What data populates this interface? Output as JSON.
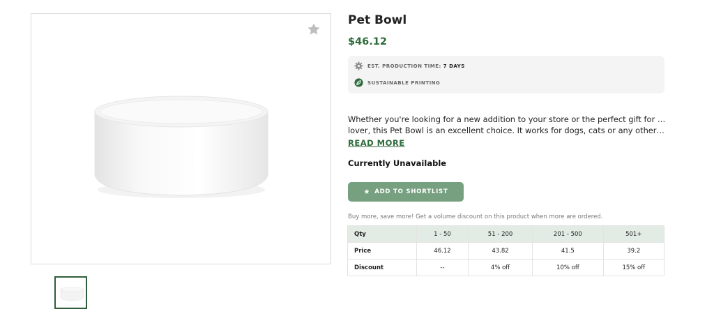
{
  "product": {
    "title": "Pet Bowl",
    "price": "$46.12",
    "production_label": "EST. PRODUCTION TIME:",
    "production_value": "7 DAYS",
    "sustainable_label": "SUSTAINABLE PRINTING",
    "description_line1": "Whether you're looking for a new addition to your store or the perfect gift for a pet",
    "description_line2": "lover, this Pet Bowl is an excellent choice. It works for dogs, cats or any other type o…",
    "read_more": "READ MORE",
    "availability": "Currently Unavailable",
    "shortlist_label": "ADD TO SHORTLIST",
    "volume_note": "Buy more, save more! Get a volume discount on this product when more are ordered."
  },
  "pricing_table": {
    "headers": [
      "Qty",
      "1 - 50",
      "51 - 200",
      "201 - 500",
      "501+"
    ],
    "rows": [
      [
        "Price",
        "46.12",
        "43.82",
        "41.5",
        "39.2"
      ],
      [
        "Discount",
        "--",
        "4% off",
        "10% off",
        "15% off"
      ]
    ]
  },
  "colors": {
    "accent_green": "#2e6b3b",
    "button_green": "#76a07f",
    "table_header_bg": "#e2ebe4"
  },
  "icons": {
    "favorite": "star-icon",
    "production": "gear-icon",
    "sustainable": "leaf-icon",
    "shortlist": "star-icon"
  }
}
